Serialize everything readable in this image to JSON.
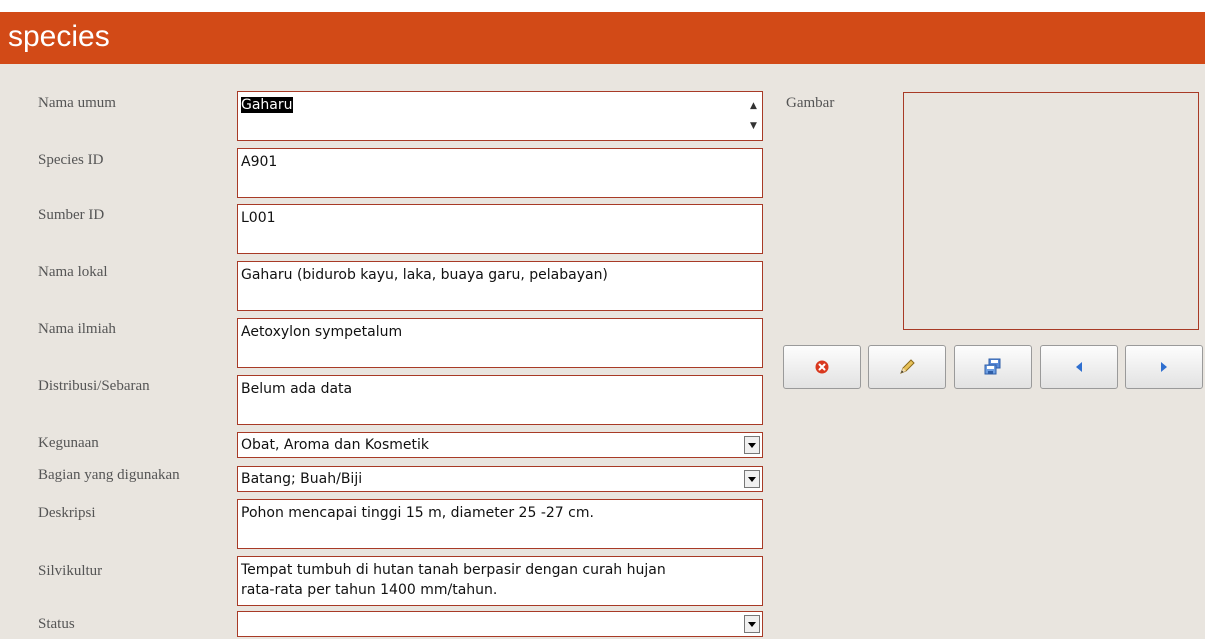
{
  "header": {
    "title": "species"
  },
  "form": {
    "nama_umum": {
      "label": "Nama umum",
      "value": "Gaharu"
    },
    "species_id": {
      "label": "Species ID",
      "value": "A901"
    },
    "sumber_id": {
      "label": "Sumber ID",
      "value": "L001"
    },
    "nama_lokal": {
      "label": "Nama lokal",
      "value": "Gaharu (bidurob kayu, laka, buaya garu, pelabayan)"
    },
    "nama_ilmiah": {
      "label": "Nama ilmiah",
      "value": "Aetoxylon sympetalum"
    },
    "distribusi": {
      "label": "Distribusi/Sebaran",
      "value": "Belum ada data"
    },
    "kegunaan": {
      "label": "Kegunaan",
      "value": "Obat, Aroma dan Kosmetik"
    },
    "bagian": {
      "label": "Bagian yang digunakan",
      "value": "Batang; Buah/Biji"
    },
    "deskripsi": {
      "label": "Deskripsi",
      "value": "Pohon mencapai tinggi 15 m, diameter 25 -27 cm."
    },
    "silvikultur": {
      "label": "Silvikultur",
      "line1": "Tempat tumbuh di hutan tanah berpasir dengan curah hujan",
      "line2": "rata-rata per tahun 1400 mm/tahun."
    },
    "status": {
      "label": "Status",
      "value": ""
    },
    "gambar": {
      "label": "Gambar"
    }
  },
  "buttons": [
    {
      "icon": "delete-icon"
    },
    {
      "icon": "pencil-icon"
    },
    {
      "icon": "save-icon"
    },
    {
      "icon": "previous-icon"
    },
    {
      "icon": "next-icon"
    }
  ],
  "colors": {
    "header": "#d24a17",
    "form_bg": "#e9e5df",
    "field_border": "#a83a26"
  }
}
